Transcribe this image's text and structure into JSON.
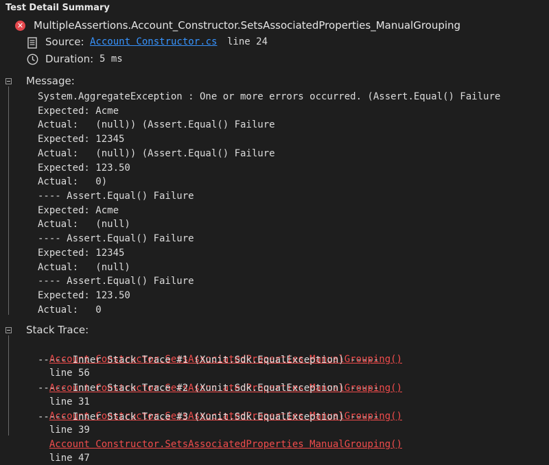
{
  "header": {
    "title": "Test Detail Summary"
  },
  "test": {
    "name": "MultipleAssertions.Account_Constructor.SetsAssociatedProperties_ManualGrouping",
    "source_label": "Source:",
    "source_link": "Account Constructor.cs",
    "source_line": "line 24",
    "duration_label": "Duration:",
    "duration_value": "5 ms"
  },
  "message": {
    "label": "Message:",
    "lines": [
      "System.AggregateException : One or more errors occurred. (Assert.Equal() Failure",
      "Expected: Acme",
      "Actual:   (null)) (Assert.Equal() Failure",
      "Expected: 12345",
      "Actual:   (null)) (Assert.Equal() Failure",
      "Expected: 123.50",
      "Actual:   0)",
      "---- Assert.Equal() Failure",
      "Expected: Acme",
      "Actual:   (null)",
      "---- Assert.Equal() Failure",
      "Expected: 12345",
      "Actual:   (null)",
      "---- Assert.Equal() Failure",
      "Expected: 123.50",
      "Actual:   0"
    ]
  },
  "stack": {
    "label": "Stack Trace:",
    "frame_link": "Account Constructor.SetsAssociatedProperties ManualGrouping()",
    "frame1_line": "line 56",
    "inner1": "----- Inner Stack Trace #1 (Xunit.Sdk.EqualException) -----",
    "frame2_line": "line 31",
    "inner2": "----- Inner Stack Trace #2 (Xunit.Sdk.EqualException) -----",
    "frame3_line": "line 39",
    "inner3": "----- Inner Stack Trace #3 (Xunit.Sdk.EqualException) -----",
    "frame4_line": "line 47"
  },
  "colors": {
    "background": "#1e1e1e",
    "link": "#3794ff",
    "error": "#f14c4c",
    "fail_icon": "#e5484d"
  },
  "icons": [
    "fail-icon",
    "file-icon",
    "clock-icon",
    "collapse-icon"
  ]
}
